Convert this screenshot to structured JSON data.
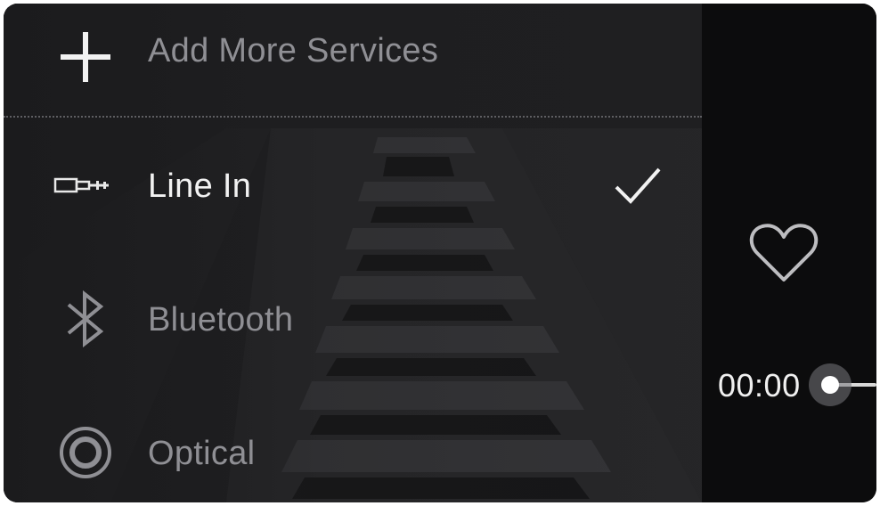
{
  "menu": {
    "add_more": {
      "label": "Add More Services",
      "icon": "plus-icon"
    },
    "items": [
      {
        "label": "Line In",
        "icon": "line-in-plug-icon",
        "selected": true
      },
      {
        "label": "Bluetooth",
        "icon": "bluetooth-icon",
        "selected": false
      },
      {
        "label": "Optical",
        "icon": "optical-icon",
        "selected": false
      }
    ]
  },
  "player": {
    "elapsed": "00:00",
    "favorite_icon": "heart-icon",
    "progress": 0
  },
  "colors": {
    "panel_bg": "#1d1d1f",
    "sidebar_bg": "#0c0c0d",
    "active_text": "#f2f2f2",
    "inactive_text": "#8f8f94"
  }
}
